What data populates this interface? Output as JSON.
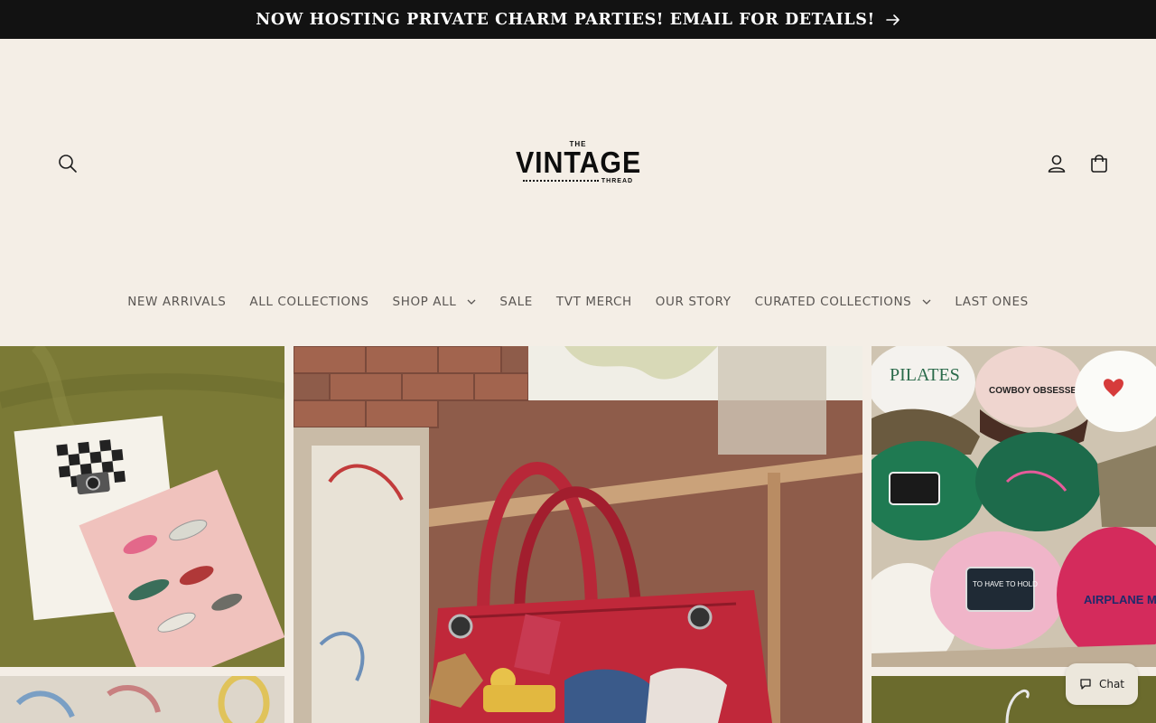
{
  "announcement": {
    "text": "NOW HOSTING PRIVATE CHARM PARTIES! EMAIL FOR DETAILS!",
    "arrow_icon": "arrow-right-icon"
  },
  "header": {
    "search_icon": "search-icon",
    "account_icon": "account-icon",
    "cart_icon": "cart-icon",
    "logo": {
      "top": "THE",
      "main": "VINTAGE",
      "bottom": "THREAD"
    }
  },
  "nav": {
    "items": [
      {
        "label": "NEW ARRIVALS",
        "has_dropdown": false
      },
      {
        "label": "ALL COLLECTIONS",
        "has_dropdown": false
      },
      {
        "label": "SHOP ALL",
        "has_dropdown": true
      },
      {
        "label": "SALE",
        "has_dropdown": false
      },
      {
        "label": "TVT MERCH",
        "has_dropdown": false
      },
      {
        "label": "OUR STORY",
        "has_dropdown": false
      },
      {
        "label": "CURATED COLLECTIONS",
        "has_dropdown": true
      },
      {
        "label": "LAST ONES",
        "has_dropdown": false
      }
    ]
  },
  "gallery": {
    "tiles": [
      {
        "name": "shoe-print-photo"
      },
      {
        "name": "red-charm-bag-photo"
      },
      {
        "name": "trucker-hats-photo"
      },
      {
        "name": "illustration-photo"
      },
      {
        "name": "green-chair-photo"
      }
    ],
    "hat_texts": {
      "pilates": "PILATES",
      "cowboy": "COWBOY OBSESSED",
      "airplane": "AIRPLANE MODE",
      "to_have": "TO HAVE TO HOLD"
    }
  },
  "chat": {
    "label": "Chat",
    "icon": "chat-bubble-icon"
  },
  "colors": {
    "background": "#f4eee6",
    "announcement_bg": "#121212",
    "nav_text": "#5a5653"
  }
}
